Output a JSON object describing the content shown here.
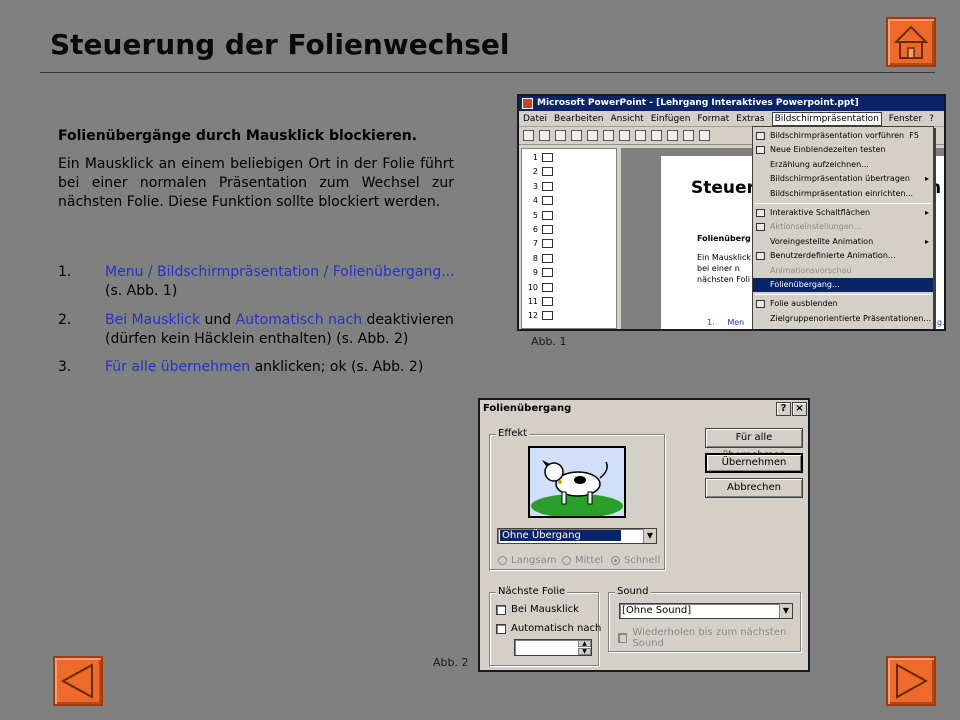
{
  "title": "Steuerung der Folienwechsel",
  "intro": {
    "heading": "Folienübergänge durch Mausklick blockieren.",
    "body": "Ein Mausklick an einem beliebigen Ort in der Folie führt bei einer normalen Präsentation zum Wechsel zur nächsten Folie. Diese Funktion sollte blockiert werden."
  },
  "steps": [
    {
      "num": "1.",
      "link": "Menu / Bildschirmpräsentation / Folienübergang...",
      "rest": "(s. Abb. 1)"
    },
    {
      "num": "2.",
      "link1": "Bei Mausklick",
      "mid1": " und ",
      "link2": "Automatisch nach",
      "mid2": " deaktivieren (dürfen kein Häcklein enthalten) (s. Abb. 2)"
    },
    {
      "num": "3.",
      "link": "Für alle übernehmen",
      "rest": " anklicken; ok (s. Abb. 2)"
    }
  ],
  "figure1": {
    "caption": "Abb. 1",
    "window_title": "Microsoft PowerPoint - [Lehrgang Interaktives Powerpoint.ppt]",
    "menu": [
      "Datei",
      "Bearbeiten",
      "Ansicht",
      "Einfügen",
      "Format",
      "Extras",
      "Bildschirmpräsentation",
      "Fenster",
      "?"
    ],
    "outline_numbers": [
      "1",
      "2",
      "3",
      "4",
      "5",
      "6",
      "7",
      "8",
      "9",
      "10",
      "11",
      "12"
    ],
    "slide": {
      "title": "Steuer",
      "title_tail": "h",
      "subtitle": "Folienüberg",
      "body": [
        "Ein Mausklick",
        "bei einer n",
        "nächsten Foli"
      ],
      "list": "1.     Men",
      "list_tail": "g..."
    },
    "dropdown": [
      {
        "label": "Bildschirmpräsentation vorführen",
        "shortcut": "F5",
        "icon": true
      },
      {
        "label": "Neue Einblendezeiten testen",
        "icon": true
      },
      {
        "label": "Erzählung aufzeichnen..."
      },
      {
        "label": "Bildschirmpräsentation übertragen",
        "submenu": true
      },
      {
        "label": "Bildschirmpräsentation einrichten..."
      },
      {
        "sep": true
      },
      {
        "label": "Interaktive Schaltflächen",
        "submenu": true,
        "icon": true
      },
      {
        "label": "Aktionseinstellungen...",
        "disabled": true,
        "icon": true
      },
      {
        "label": "Voreingestellte Animation",
        "submenu": true
      },
      {
        "label": "Benutzerdefinierte Animation...",
        "icon": true
      },
      {
        "label": "Animationsvorschau",
        "disabled": true
      },
      {
        "label": "Folienübergang...",
        "selected": true
      },
      {
        "sep": true
      },
      {
        "label": "Folie ausblenden",
        "icon": true
      },
      {
        "label": "Zielgruppenorientierte Präsentationen..."
      }
    ]
  },
  "figure2": {
    "caption": "Abb. 2",
    "title": "Folienübergang",
    "help": "?",
    "close": "×",
    "effekt_label": "Effekt",
    "effect_value": "Ohne Übergang",
    "speed": [
      {
        "label": "Langsam",
        "selected": false
      },
      {
        "label": "Mittel",
        "selected": false
      },
      {
        "label": "Schnell",
        "selected": true
      }
    ],
    "buttons": [
      "Für alle übernehmen",
      "Übernehmen",
      "Abbrechen"
    ],
    "next_label": "Nächste Folie",
    "on_click": "Bei Mausklick",
    "auto": "Automatisch nach",
    "sound_label": "Sound",
    "sound_value": "[Ohne Sound]",
    "loop": "Wiederholen bis zum nächsten Sound"
  },
  "colors": {
    "background": "#808080",
    "accent": "#ee6a2a",
    "link": "#2432c8",
    "title_bar": "#0a246a"
  }
}
